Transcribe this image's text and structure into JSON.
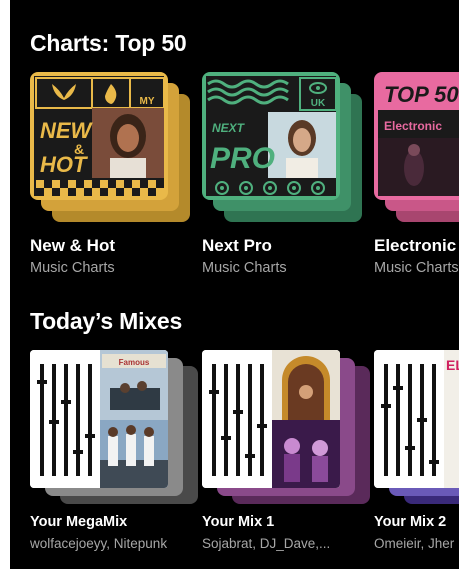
{
  "sections": {
    "charts": {
      "title": "Charts: Top 50",
      "cards": [
        {
          "title": "New & Hot",
          "subtitle": "Music Charts",
          "badge": "MY",
          "art_text_1": "NEW",
          "art_text_2": "&",
          "art_text_3": "HOT",
          "color": "#e9b949"
        },
        {
          "title": "Next Pro",
          "subtitle": "Music Charts",
          "badge": "UK",
          "art_text_1": "NEXT",
          "art_text_2": "PRO",
          "color": "#4fb07e"
        },
        {
          "title": "Electronic",
          "subtitle": "Music Charts",
          "art_text_1": "TOP 50",
          "art_text_2": "Electronic",
          "color": "#e86aa0"
        }
      ]
    },
    "mixes": {
      "title": "Today’s Mixes",
      "cards": [
        {
          "title": "Your MegaMix",
          "subtitle": "wolfacejoeyy, Nitepunk",
          "cover_text": "Famous"
        },
        {
          "title": "Your Mix 1",
          "subtitle": "Sojabrat, DJ_Dave,..."
        },
        {
          "title": "Your Mix 2",
          "subtitle": "Omeieir, Jher",
          "cover_text": "ELVIS"
        }
      ]
    }
  },
  "colors": {
    "background": "#000000",
    "new_hot": "#e9b949",
    "next_pro": "#4fb07e",
    "electronic": "#e86aa0",
    "subtitle": "#a7a7a7"
  }
}
